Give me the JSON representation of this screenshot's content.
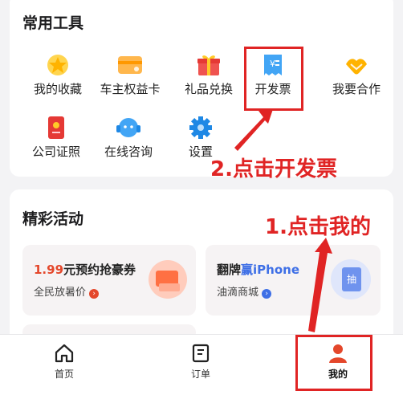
{
  "tools": {
    "title": "常用工具",
    "items": [
      {
        "label": "我的收藏",
        "icon": "star-icon"
      },
      {
        "label": "车主权益卡",
        "icon": "card-icon"
      },
      {
        "label": "礼品兑换",
        "icon": "gift-icon"
      },
      {
        "label": "开发票",
        "icon": "invoice-icon"
      },
      {
        "label": "我要合作",
        "icon": "handshake-icon"
      },
      {
        "label": "公司证照",
        "icon": "certificate-icon"
      },
      {
        "label": "在线咨询",
        "icon": "headset-icon"
      },
      {
        "label": "设置",
        "icon": "gear-icon"
      }
    ]
  },
  "activities": {
    "title": "精彩活动",
    "promo1": {
      "price": "1.99",
      "title_rest": "元预约抢豪券",
      "subtitle": "全民放暑价"
    },
    "promo2": {
      "title_prefix": "翻牌",
      "title_highlight": "赢iPhone",
      "subtitle": "油滴商城",
      "badge": "抽"
    }
  },
  "tabbar": {
    "items": [
      {
        "label": "首页",
        "icon": "home-icon"
      },
      {
        "label": "订单",
        "icon": "order-icon"
      },
      {
        "label": "我的",
        "icon": "profile-icon"
      }
    ]
  },
  "annotations": {
    "step1": "1.点击我的",
    "step2": "2.点击开发票"
  },
  "colors": {
    "annotation": "#e02424",
    "accent_red": "#e4472b",
    "accent_blue": "#3e6fe6"
  }
}
